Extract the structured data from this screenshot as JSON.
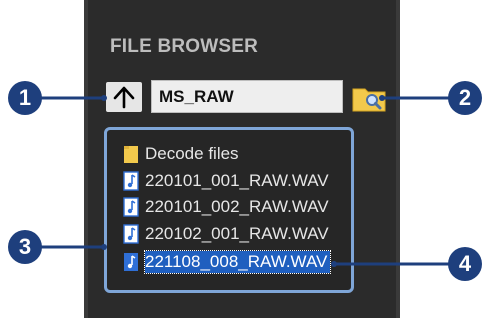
{
  "panel": {
    "title": "FILE BROWSER"
  },
  "path": {
    "value": "MS_RAW"
  },
  "list": {
    "items": [
      {
        "label": "Decode files",
        "kind": "folder"
      },
      {
        "label": "220101_001_RAW.WAV",
        "kind": "audio"
      },
      {
        "label": "220101_002_RAW.WAV",
        "kind": "audio"
      },
      {
        "label": "220102_001_RAW.WAV",
        "kind": "audio"
      },
      {
        "label": "221108_008_RAW.WAV",
        "kind": "audio",
        "selected": true
      }
    ]
  },
  "callouts": [
    "1",
    "2",
    "3",
    "4"
  ],
  "colors": {
    "callout": "#1e3f7d",
    "highlight": "#7fa6d8",
    "selection": "#1f5fbf",
    "folder": "#f2c94c"
  },
  "icons": {
    "up": "arrow-up-icon",
    "search": "folder-search-icon",
    "folder": "folder-icon",
    "audio": "audio-file-icon"
  }
}
